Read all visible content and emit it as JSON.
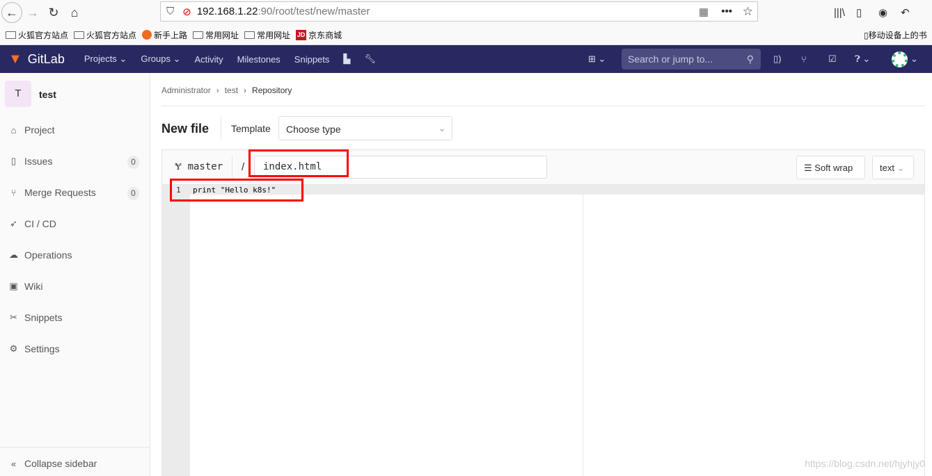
{
  "browser": {
    "url_host": "192.168.1.22",
    "url_rest": ":90/root/test/new/master",
    "bookmarks": [
      {
        "label": "火狐官方站点",
        "icon": "folder-icon"
      },
      {
        "label": "火狐官方站点",
        "icon": "folder-icon"
      },
      {
        "label": "新手上路",
        "icon": "firefox-icon"
      },
      {
        "label": "常用网址",
        "icon": "folder-icon"
      },
      {
        "label": "常用网址",
        "icon": "folder-icon"
      },
      {
        "label": "京东商城",
        "icon": "jd-icon"
      }
    ],
    "mobile_bookmarks": "移动设备上的书"
  },
  "navbar": {
    "brand": "GitLab",
    "items": [
      "Projects",
      "Groups",
      "Activity",
      "Milestones",
      "Snippets"
    ],
    "search_placeholder": "Search or jump to..."
  },
  "sidebar": {
    "avatar_letter": "T",
    "project": "test",
    "items": [
      {
        "label": "Project",
        "icon": "home-icon"
      },
      {
        "label": "Issues",
        "icon": "issues-icon",
        "count": "0"
      },
      {
        "label": "Merge Requests",
        "icon": "merge-request-icon",
        "count": "0"
      },
      {
        "label": "CI / CD",
        "icon": "rocket-icon"
      },
      {
        "label": "Operations",
        "icon": "cloud-gear-icon"
      },
      {
        "label": "Wiki",
        "icon": "book-icon"
      },
      {
        "label": "Snippets",
        "icon": "scissors-icon"
      },
      {
        "label": "Settings",
        "icon": "gear-icon"
      }
    ],
    "collapse": "Collapse sidebar"
  },
  "breadcrumb": [
    "Administrator",
    "test",
    "Repository"
  ],
  "page": {
    "title": "New file",
    "template_label": "Template",
    "template_value": "Choose type"
  },
  "editor": {
    "branch": "master",
    "separator": "/",
    "filename": "index.html",
    "soft_wrap": "Soft wrap",
    "mode": "text",
    "lines": [
      {
        "n": "1",
        "code": "print \"Hello k8s!\""
      }
    ]
  },
  "watermark": "https://blog.csdn.net/hjyhjy0",
  "colors": {
    "navbar": "#292961",
    "highlight": "#ff0000"
  }
}
